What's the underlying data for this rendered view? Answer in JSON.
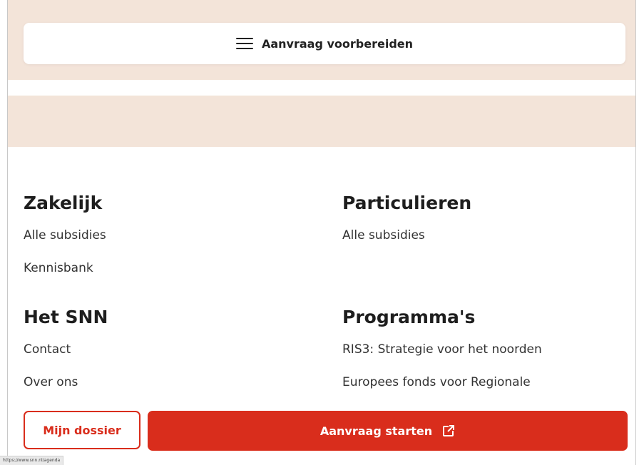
{
  "header": {
    "accordion_label": "Aanvraag voorbereiden",
    "icon": "hamburger-menu-icon"
  },
  "footer_nav": {
    "zakelijk": {
      "title": "Zakelijk",
      "links": [
        "Alle subsidies",
        "Kennisbank"
      ]
    },
    "particulieren": {
      "title": "Particulieren",
      "links": [
        "Alle subsidies"
      ]
    },
    "het_snn": {
      "title": "Het SNN",
      "links": [
        "Contact",
        "Over ons"
      ]
    },
    "programmas": {
      "title": "Programma's",
      "links": [
        "RIS3: Strategie voor het noorden",
        "Europees fonds voor Regionale"
      ]
    }
  },
  "actions": {
    "dossier_label": "Mijn dossier",
    "start_label": "Aanvraag starten",
    "start_icon": "external-link-icon"
  },
  "status_bar": {
    "url": "https://www.snn.nl/agenda"
  },
  "colors": {
    "accent": "#d92d1c",
    "header_bg": "#f3e4d9",
    "text": "#1e1e1e"
  }
}
